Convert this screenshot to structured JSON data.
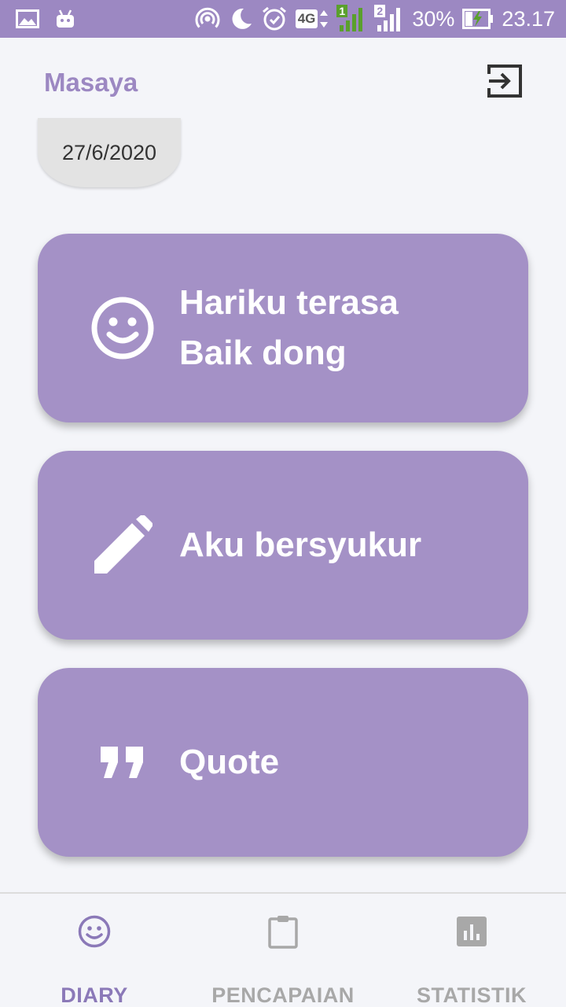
{
  "status_bar": {
    "battery_percent": "30%",
    "time": "23.17",
    "network_type": "4G",
    "sim1": "1",
    "sim2": "2",
    "icons": [
      "gallery-icon",
      "android-icon",
      "hotspot-icon",
      "do-not-disturb-icon",
      "alarm-icon",
      "network-4g-icon",
      "signal-sim1-icon",
      "signal-sim2-icon",
      "battery-charging-icon"
    ]
  },
  "header": {
    "user_name": "Masaya",
    "logout_icon": "logout-icon"
  },
  "date_chip": {
    "date": "27/6/2020"
  },
  "cards": [
    {
      "icon": "smile-icon",
      "line1": "Hariku terasa",
      "line2": "Baik dong"
    },
    {
      "icon": "pencil-icon",
      "label": "Aku bersyukur"
    },
    {
      "icon": "quote-icon",
      "label": "Quote"
    }
  ],
  "bottom_nav": {
    "items": [
      {
        "label": "DIARY",
        "icon": "smile-outline-icon",
        "active": true
      },
      {
        "label": "PENCAPAIAN",
        "icon": "clipboard-icon",
        "active": false
      },
      {
        "label": "STATISTIK",
        "icon": "bar-chart-icon",
        "active": false
      }
    ]
  },
  "colors": {
    "accent": "#9c88c2",
    "card": "#a491c6",
    "background": "#f4f5f9",
    "inactive": "#a8a8a8"
  }
}
